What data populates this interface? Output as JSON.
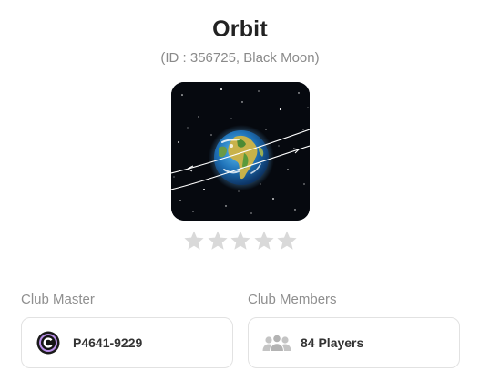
{
  "club": {
    "name": "Orbit",
    "subtitle": "(ID : 356725, Black Moon)",
    "rating": 0,
    "rating_max": 5
  },
  "master": {
    "label": "Club Master",
    "player_id": "P4641-9229"
  },
  "members": {
    "label": "Club Members",
    "count_text": "84 Players"
  },
  "icons": [
    "club-earth-orbit-image",
    "star-icon",
    "master-avatar-icon",
    "players-group-icon"
  ],
  "colors": {
    "star_empty": "#d9d9d9",
    "title": "#222222",
    "subtitle": "#8a8a8a",
    "card_border": "#e2e2e2"
  }
}
